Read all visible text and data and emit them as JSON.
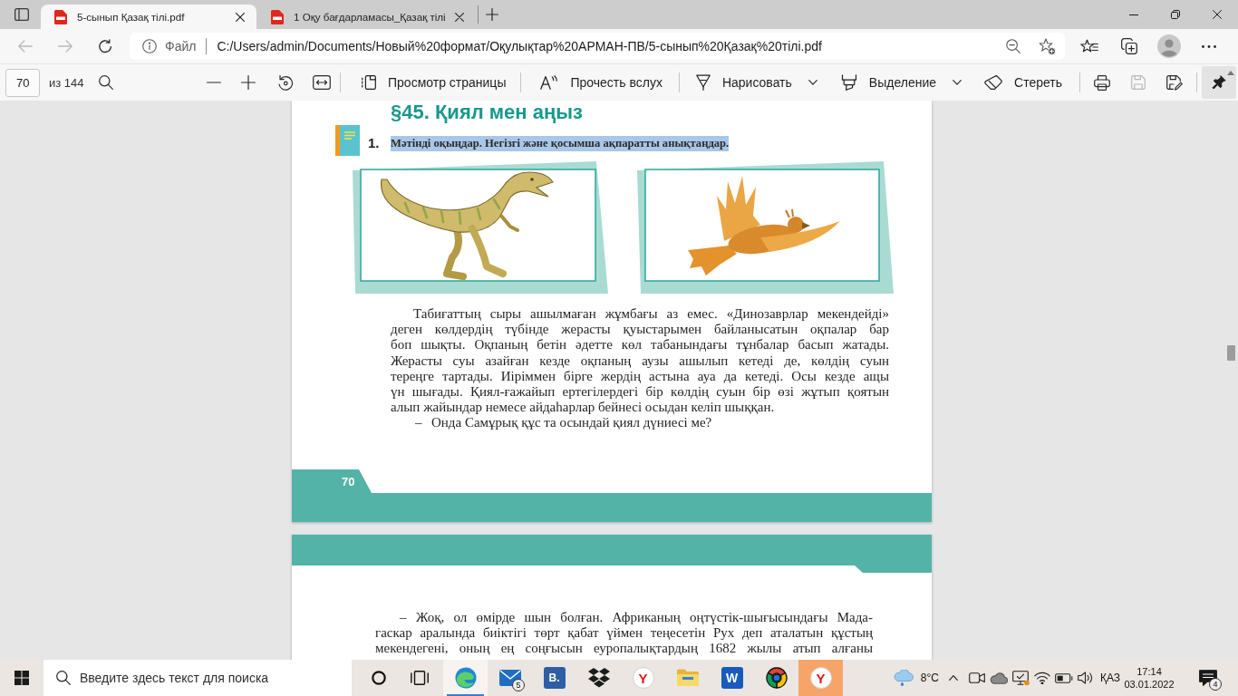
{
  "browser": {
    "tabs": [
      {
        "title": "5-сынып Қазақ тілі.pdf",
        "selected": true
      },
      {
        "title": "1 Оқу бағдарламасы_Қазақ тілі",
        "selected": false
      }
    ],
    "back": {
      "disabled": true
    },
    "forward": {
      "disabled": true
    },
    "address": {
      "scheme": "Файл",
      "url": "C:/Users/admin/Documents/Новый%20формат/Оқулықтар%20АРМАН-ПВ/5-сынып%20Қазақ%20тілі.pdf"
    }
  },
  "pdf_toolbar": {
    "page_number": "70",
    "page_count": "из 144",
    "tools": [
      {
        "kind": "page_view",
        "label": "Просмотр страницы",
        "menu": false
      },
      {
        "kind": "read_aloud",
        "label": "Прочесть вслух",
        "menu": false
      },
      {
        "kind": "draw",
        "label": "Нарисовать",
        "menu": true
      },
      {
        "kind": "highlight",
        "label": "Выделение",
        "menu": true
      },
      {
        "kind": "erase",
        "label": "Стереть",
        "menu": false
      }
    ],
    "actions": [
      {
        "kind": "print",
        "disabled": false
      },
      {
        "kind": "save",
        "disabled": true
      },
      {
        "kind": "save_as",
        "disabled": false
      }
    ],
    "pinned": true
  },
  "document": {
    "pages": [
      {
        "heading": "§45. Қиял мен аңыз",
        "task": {
          "number": "1.",
          "instruction": "Мәтінді оқыңдар. Негізгі және қосымша ақпаратты анықтаңдар.",
          "highlighted": true
        },
        "figures": [
          {
            "kind": "dinosaur"
          },
          {
            "kind": "bird"
          }
        ],
        "paragraphs": [
          {
            "lines": [
              "Табиғаттың сыры ашылмаған жұмбағы аз емес. «Динозаврлар мекендейді»",
              "деген көлдердің түбінде жерасты қуыстарымен байланысатын оқпалар бар",
              "боп шықты. Оқпаның бетін әдетте көл табанындағы тұнбалар басып жатады.",
              "Жерасты суы азайған кезде оқпаның аузы ашылып кетеді де, көлдің суын",
              "тереңге тартады. Иіріммен бірге жердің астына ауа да кетеді. Осы кезде ащы",
              "үн шығады. Қиял-ғажайып ертегілердегі бір көлдің суын бір өзі жұтып қоятын",
              "алып жайындар немесе айдаһарлар бейнесі осыдан келіп шыққан."
            ],
            "continues": false
          },
          {
            "dash": "–",
            "lines": [
              "Онда Самұрық құс та осындай қиял дүниесі ме?"
            ],
            "continues": false
          }
        ],
        "footer": {
          "page_number": "70"
        }
      },
      {
        "header_band": true,
        "paragraphs": [
          {
            "dash": "–",
            "lines": [
              "Жоқ, ол өмірде шын болған. Африканың оңтүстік-шығысындағы Мада-",
              "гаскар аралында биіктігі төрт қабат үймен теңесетін Рух деп аталатын құстың",
              "мекендегені, оның ең соңғысын еуропалықтардың 1682 жылы атып алғаны"
            ],
            "continues": true
          }
        ]
      }
    ]
  },
  "taskbar": {
    "search": {
      "placeholder": "Введите здесь текст для поиска"
    },
    "apps": [
      {
        "kind": "cortana",
        "selected": false,
        "flashing": false
      },
      {
        "kind": "task_view",
        "selected": false,
        "flashing": false
      },
      {
        "kind": "edge",
        "selected": true,
        "flashing": false
      },
      {
        "kind": "mail",
        "badge": "5",
        "selected": false,
        "flashing": false
      },
      {
        "kind": "tile",
        "glyph": "B.",
        "selected": false,
        "flashing": false
      },
      {
        "kind": "dropbox",
        "selected": false,
        "flashing": false
      },
      {
        "kind": "yandex",
        "glyph": "Y",
        "selected": false,
        "flashing": false
      },
      {
        "kind": "folder",
        "selected": false,
        "flashing": false
      },
      {
        "kind": "word",
        "glyph": "W",
        "selected": false,
        "flashing": false
      },
      {
        "kind": "chrome",
        "selected": false,
        "flashing": false
      },
      {
        "kind": "yandex",
        "glyph": "Y",
        "selected": false,
        "flashing": true
      }
    ],
    "tray": {
      "weather": "8°C",
      "language": "ҚАЗ",
      "time": "17:14",
      "date": "03.01.2022",
      "notifications": "4"
    }
  }
}
